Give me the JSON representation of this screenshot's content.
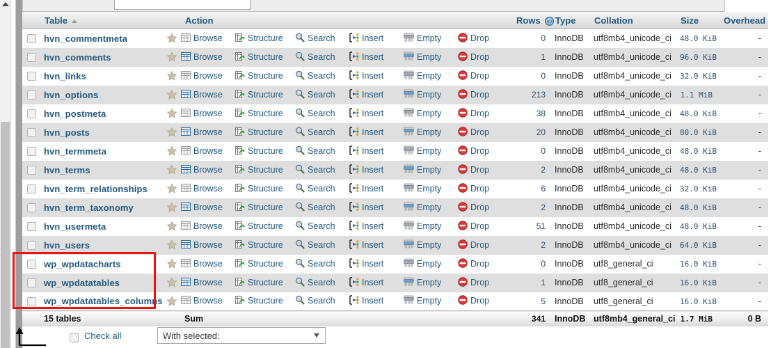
{
  "window": {
    "app": "phpMyAdmin",
    "view": "database-table-list"
  },
  "table_header": {
    "check": "",
    "table": "Table",
    "sort_indicator": "ascending",
    "action": "Action",
    "rows": "Rows",
    "rows_help_icon": "help-circle-icon",
    "type": "Type",
    "collation": "Collation",
    "size": "Size",
    "overhead": "Overhead"
  },
  "actions": {
    "browse": "Browse",
    "structure": "Structure",
    "search": "Search",
    "insert": "Insert",
    "empty": "Empty",
    "drop": "Drop",
    "favorite_icon": "star-icon",
    "browse_icon": "grid-icon",
    "structure_icon": "structure-icon",
    "search_icon": "magnifier-icon",
    "insert_icon": "insert-row-icon",
    "empty_icon": "shredder-icon",
    "drop_icon": "no-entry-icon"
  },
  "rows": [
    {
      "name": "hvn_commentmeta",
      "rows": "0",
      "type": "InnoDB",
      "collation": "utf8mb4_unicode_ci",
      "size": "48.0 KiB",
      "overhead": "-"
    },
    {
      "name": "hvn_comments",
      "rows": "1",
      "type": "InnoDB",
      "collation": "utf8mb4_unicode_ci",
      "size": "96.0 KiB",
      "overhead": "-"
    },
    {
      "name": "hvn_links",
      "rows": "0",
      "type": "InnoDB",
      "collation": "utf8mb4_unicode_ci",
      "size": "32.0 KiB",
      "overhead": "-"
    },
    {
      "name": "hvn_options",
      "rows": "213",
      "type": "InnoDB",
      "collation": "utf8mb4_unicode_ci",
      "size": "1.1 MiB",
      "overhead": "-"
    },
    {
      "name": "hvn_postmeta",
      "rows": "38",
      "type": "InnoDB",
      "collation": "utf8mb4_unicode_ci",
      "size": "48.0 KiB",
      "overhead": "-"
    },
    {
      "name": "hvn_posts",
      "rows": "20",
      "type": "InnoDB",
      "collation": "utf8mb4_unicode_ci",
      "size": "80.0 KiB",
      "overhead": "-"
    },
    {
      "name": "hvn_termmeta",
      "rows": "0",
      "type": "InnoDB",
      "collation": "utf8mb4_unicode_ci",
      "size": "48.0 KiB",
      "overhead": "-"
    },
    {
      "name": "hvn_terms",
      "rows": "2",
      "type": "InnoDB",
      "collation": "utf8mb4_unicode_ci",
      "size": "48.0 KiB",
      "overhead": "-"
    },
    {
      "name": "hvn_term_relationships",
      "rows": "6",
      "type": "InnoDB",
      "collation": "utf8mb4_unicode_ci",
      "size": "32.0 KiB",
      "overhead": "-"
    },
    {
      "name": "hvn_term_taxonomy",
      "rows": "2",
      "type": "InnoDB",
      "collation": "utf8mb4_unicode_ci",
      "size": "48.0 KiB",
      "overhead": "-"
    },
    {
      "name": "hvn_usermeta",
      "rows": "51",
      "type": "InnoDB",
      "collation": "utf8mb4_unicode_ci",
      "size": "48.0 KiB",
      "overhead": "-"
    },
    {
      "name": "hvn_users",
      "rows": "2",
      "type": "InnoDB",
      "collation": "utf8mb4_unicode_ci",
      "size": "64.0 KiB",
      "overhead": "-"
    },
    {
      "name": "wp_wpdatacharts",
      "rows": "0",
      "type": "InnoDB",
      "collation": "utf8_general_ci",
      "size": "16.0 KiB",
      "overhead": "-"
    },
    {
      "name": "wp_wpdatatables",
      "rows": "1",
      "type": "InnoDB",
      "collation": "utf8_general_ci",
      "size": "16.0 KiB",
      "overhead": "-"
    },
    {
      "name": "wp_wpdatatables_columns",
      "rows": "5",
      "type": "InnoDB",
      "collation": "utf8_general_ci",
      "size": "16.0 KiB",
      "overhead": "-"
    }
  ],
  "summary": {
    "tables_count": "15 tables",
    "sum_label": "Sum",
    "rows_total": "341",
    "type": "InnoDB",
    "collation": "utf8mb4_general_ci",
    "size": "1.7 MiB",
    "overhead": "0 B"
  },
  "footer": {
    "check_all": "Check all",
    "with_selected": "With selected:",
    "caret_icon": "chevron-down-icon"
  },
  "annotations": {
    "highlight_box_color": "#ee1111",
    "arrow_color": "#000000",
    "highlight_target": "wp_-prefixed tables"
  }
}
